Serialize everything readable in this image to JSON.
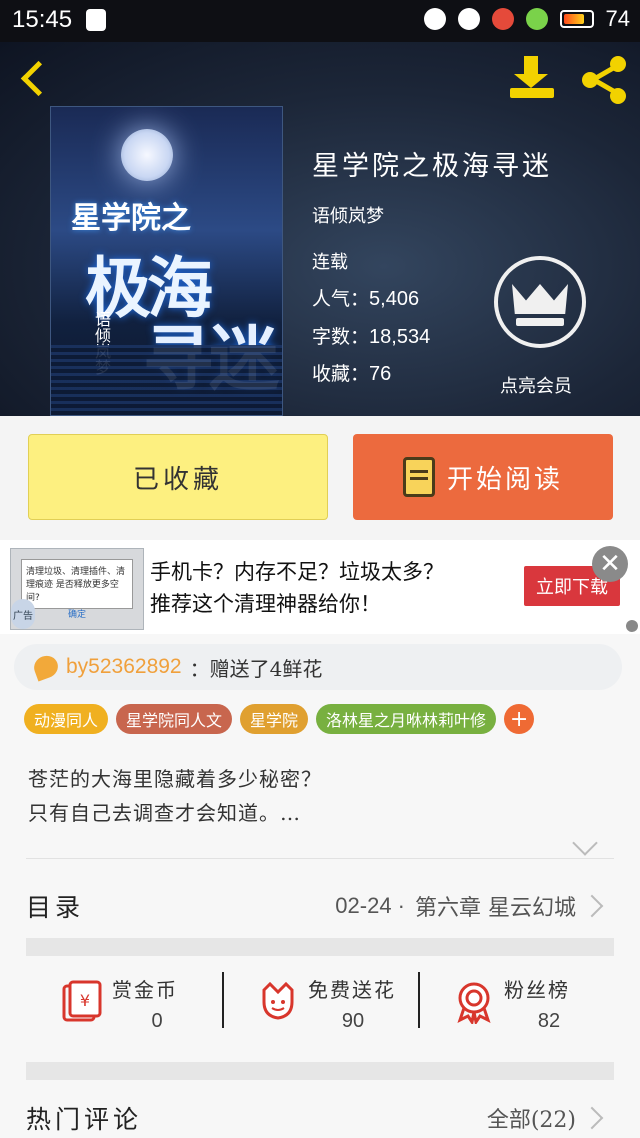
{
  "status_bar": {
    "time": "15:45",
    "battery": "74"
  },
  "colors": {
    "accent_yellow": "#f2d200",
    "read_button": "#ec6a3e",
    "fav_button": "#fdf080",
    "flower_user": "#f0a03c"
  },
  "book": {
    "cover_title_1": "星学院之",
    "cover_title_2": "极海",
    "cover_title_3": "寻迷",
    "cover_author": "语倾岚梦",
    "title": "星学院之极海寻迷",
    "author": "语倾岚梦",
    "status": "连载",
    "popularity_label": "人气：",
    "popularity": "5,406",
    "word_count_label": "字数：",
    "word_count": "18,534",
    "favorites_label": "收藏：",
    "favorites": "76",
    "vip_label": "点亮会员"
  },
  "actions": {
    "favorited": "已收藏",
    "start_reading": "开始阅读"
  },
  "ad": {
    "line1": "手机卡？内存不足？垃圾太多？",
    "line2": "推荐这个清理神器给你！",
    "button": "立即下载",
    "close": "✕",
    "image_text": "清理垃圾、清理插件、清理痕迹 是否释放更多空间?",
    "image_button": "确定",
    "ad_tag": "广告"
  },
  "flower": {
    "user": "by52362892",
    "message": "：赠送了4鲜花"
  },
  "tags": [
    {
      "label": "动漫同人",
      "color": "#f0b020"
    },
    {
      "label": "星学院同人文",
      "color": "#c8664e"
    },
    {
      "label": "星学院",
      "color": "#e0a030"
    },
    {
      "label": "洛林星之月咻林莉叶修",
      "color": "#78b040"
    }
  ],
  "tag_add": "+",
  "description": {
    "line1": "苍茫的大海里隐藏着多少秘密？",
    "line2": "只有自己去调查才会知道。…"
  },
  "catalog": {
    "label": "目录",
    "date": "02-24 · ",
    "chapter": "第六章  星云幻城"
  },
  "gifts": [
    {
      "name": "赏金币",
      "value": "0",
      "icon": "red-envelope-icon"
    },
    {
      "name": "免费送花",
      "value": "90",
      "icon": "flower-icon"
    },
    {
      "name": "粉丝榜",
      "value": "82",
      "icon": "medal-icon"
    }
  ],
  "comments": {
    "label": "热门评论",
    "all": "全部(22)"
  }
}
